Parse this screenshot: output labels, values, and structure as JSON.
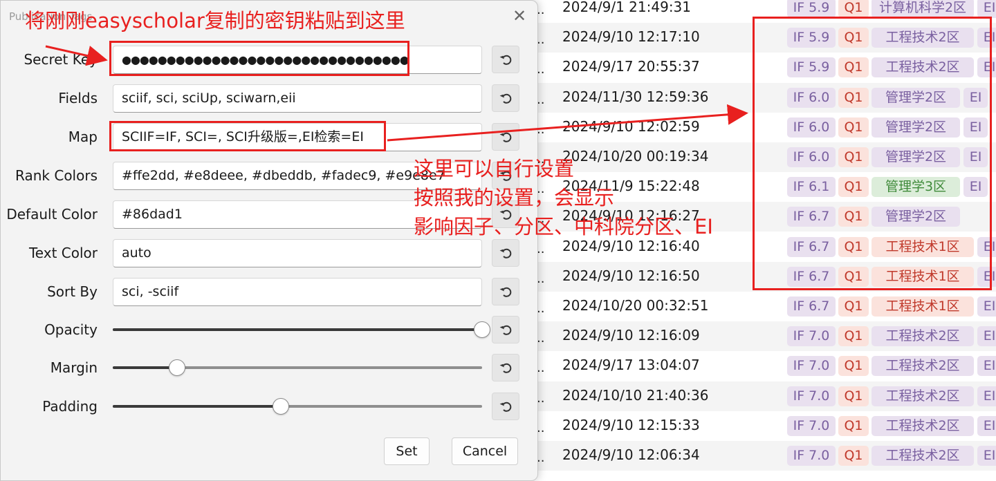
{
  "dialog": {
    "title": "Publication Tags",
    "fields": [
      {
        "label": "Secret Key",
        "value": "●●●●●●●●●●●●●●●●●●●●●●●●●●●●●●●●",
        "reset": "undo-icon"
      },
      {
        "label": "Fields",
        "value": "sciif, sci, sciUp, sciwarn,eii",
        "reset": "undo-icon"
      },
      {
        "label": "Map",
        "value": "SCIIF=IF, SCI=, SCI升级版=,EI检索=EI",
        "reset": "undo-icon"
      },
      {
        "label": "Rank Colors",
        "value": "#ffe2dd, #e8deee, #dbeddb, #fadec9, #e9e8e7",
        "reset": "undo-icon"
      },
      {
        "label": "Default Color",
        "value": "#86dad1",
        "reset": "undo-icon"
      },
      {
        "label": "Text Color",
        "value": "auto",
        "reset": "undo-icon"
      },
      {
        "label": "Sort By",
        "value": "sci, -sciif",
        "reset": "undo-icon"
      }
    ],
    "sliders": [
      {
        "label": "Opacity",
        "level": 1.0
      },
      {
        "label": "Margin",
        "level": 0.175
      },
      {
        "label": "Padding",
        "level": 0.455
      }
    ],
    "set_label": "Set",
    "cancel_label": "Cancel"
  },
  "annotations": {
    "key_instruction": "将刚刚easyscholar复制的密钥粘贴到这里",
    "custom_lines": [
      "这里可以自行设置",
      "按照我的设置，会显示",
      "影响因子、分区、中科院分区、EI"
    ]
  },
  "rows": [
    {
      "date": "2024/9/1 21:49:31",
      "if": "IF 5.9",
      "q": "Q1",
      "rank": "计算机科学2区",
      "ei": "EI"
    },
    {
      "date": "2024/9/10 12:17:10",
      "if": "IF 5.9",
      "q": "Q1",
      "rank": "工程技术2区",
      "ei": "EI"
    },
    {
      "date": "2024/9/17 20:55:37",
      "if": "IF 5.9",
      "q": "Q1",
      "rank": "工程技术2区",
      "ei": "EI"
    },
    {
      "date": "2024/11/30 12:59:36",
      "if": "IF 6.0",
      "q": "Q1",
      "rank": "管理学2区",
      "ei": "EI"
    },
    {
      "date": "2024/9/10 12:02:59",
      "if": "IF 6.0",
      "q": "Q1",
      "rank": "管理学2区",
      "ei": "EI"
    },
    {
      "date": "2024/10/20 00:19:34",
      "if": "IF 6.0",
      "q": "Q1",
      "rank": "管理学2区",
      "ei": "EI"
    },
    {
      "date": "2024/11/9 15:22:48",
      "if": "IF 6.1",
      "q": "Q1",
      "rank": "管理学3区",
      "ei": "EI"
    },
    {
      "date": "2024/9/10 12:16:27",
      "if": "IF 6.7",
      "q": "Q1",
      "rank": "管理学2区",
      "ei": ""
    },
    {
      "date": "2024/9/10 12:16:40",
      "if": "IF 6.7",
      "q": "Q1",
      "rank": "工程技术1区",
      "ei": "EI"
    },
    {
      "date": "2024/9/10 12:16:50",
      "if": "IF 6.7",
      "q": "Q1",
      "rank": "工程技术1区",
      "ei": "EI"
    },
    {
      "date": "2024/10/20 00:32:51",
      "if": "IF 6.7",
      "q": "Q1",
      "rank": "工程技术1区",
      "ei": "EI"
    },
    {
      "date": "2024/9/10 12:16:09",
      "if": "IF 7.0",
      "q": "Q1",
      "rank": "工程技术2区",
      "ei": "EI"
    },
    {
      "date": "2024/9/17 13:04:07",
      "if": "IF 7.0",
      "q": "Q1",
      "rank": "工程技术2区",
      "ei": "EI"
    },
    {
      "date": "2024/10/10 21:40:36",
      "if": "IF 7.0",
      "q": "Q1",
      "rank": "工程技术2区",
      "ei": "EI"
    },
    {
      "date": "2024/9/10 12:15:33",
      "if": "IF 7.0",
      "q": "Q1",
      "rank": "工程技术2区",
      "ei": "EI"
    },
    {
      "date": "2024/9/10 12:06:34",
      "if": "IF 7.0",
      "q": "Q1",
      "rank": "工程技术2区",
      "ei": "EI"
    }
  ],
  "colors": {
    "annotation": "#e8201f",
    "tier1": "#fbe2dc",
    "tier2": "#e9e0ef",
    "tier3": "#dcedda"
  }
}
